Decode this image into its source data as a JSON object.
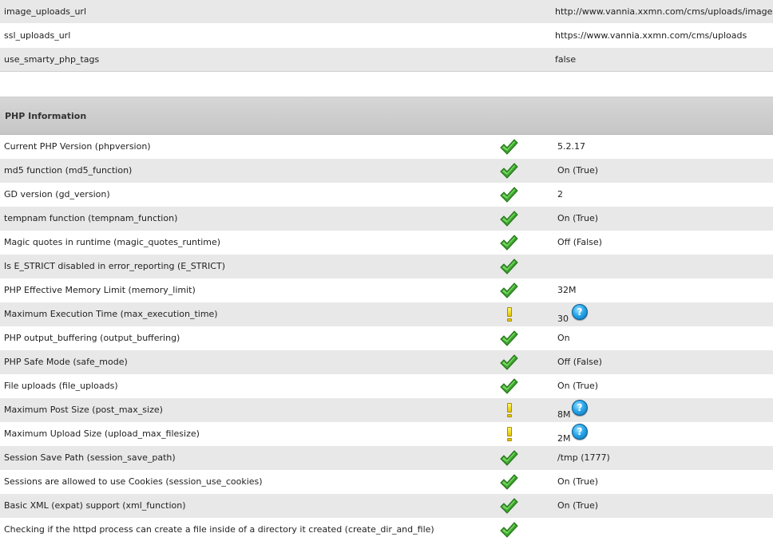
{
  "config_rows": [
    {
      "name": "image_uploads_url",
      "value": "http://www.vannia.xxmn.com/cms/uploads/images"
    },
    {
      "name": "ssl_uploads_url",
      "value": "https://www.vannia.xxmn.com/cms/uploads"
    },
    {
      "name": "use_smarty_php_tags",
      "value": "false"
    }
  ],
  "php_section": {
    "title": "PHP Information",
    "rows": [
      {
        "label": "Current PHP Version (phpversion)",
        "status": "ok",
        "value": "5.2.17"
      },
      {
        "label": "md5 function (md5_function)",
        "status": "ok",
        "value": "On (True)"
      },
      {
        "label": "GD version (gd_version)",
        "status": "ok",
        "value": "2"
      },
      {
        "label": "tempnam function (tempnam_function)",
        "status": "ok",
        "value": "On (True)"
      },
      {
        "label": "Magic quotes in runtime (magic_quotes_runtime)",
        "status": "ok",
        "value": "Off (False)"
      },
      {
        "label": "Is E_STRICT disabled in error_reporting (E_STRICT)",
        "status": "ok",
        "value": ""
      },
      {
        "label": "PHP Effective Memory Limit (memory_limit)",
        "status": "ok",
        "value": "32M"
      },
      {
        "label": "Maximum Execution Time (max_execution_time)",
        "status": "warning",
        "value": "30",
        "help": "?"
      },
      {
        "label": "PHP output_buffering (output_buffering)",
        "status": "ok",
        "value": "On"
      },
      {
        "label": "PHP Safe Mode (safe_mode)",
        "status": "ok",
        "value": "Off (False)"
      },
      {
        "label": "File uploads (file_uploads)",
        "status": "ok",
        "value": "On (True)"
      },
      {
        "label": "Maximum Post Size (post_max_size)",
        "status": "warning",
        "value": "8M",
        "help": "?"
      },
      {
        "label": "Maximum Upload Size (upload_max_filesize)",
        "status": "warning",
        "value": "2M",
        "help": "?"
      },
      {
        "label": "Session Save Path (session_save_path)",
        "status": "ok",
        "value": "/tmp (1777)"
      },
      {
        "label": "Sessions are allowed to use Cookies (session_use_cookies)",
        "status": "ok",
        "value": "On (True)"
      },
      {
        "label": "Basic XML (expat) support (xml_function)",
        "status": "ok",
        "value": "On (True)"
      },
      {
        "label": "Checking if the httpd process can create a file inside of a directory it created (create_dir_and_file)",
        "status": "ok",
        "value": ""
      }
    ]
  },
  "icons": {
    "ok": "check-icon",
    "warning": "warning-icon",
    "help": "help-icon"
  },
  "colors": {
    "check_green": "#3aa52a",
    "warning_yellow": "#f2dc1e",
    "help_blue": "#2aa7e8",
    "row_alt": "#e8e8e8",
    "header_bg": "#cfcfcf"
  }
}
